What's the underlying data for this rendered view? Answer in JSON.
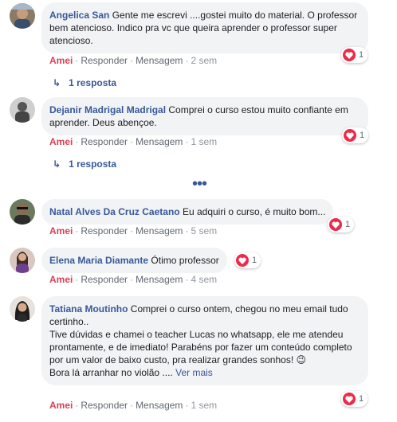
{
  "comments": [
    {
      "author": "Angelica San",
      "text": "Gente me escrevi ....gostei muito do material. O professor bem atencioso. Indico pra vc que queira aprender o professor super atencioso.",
      "like": "Amei",
      "reply": "Responder",
      "message": "Mensagem",
      "time": "2 sem",
      "reactions": "1",
      "replies": "1 resposta"
    },
    {
      "author": "Dejanir Madrigal Madrigal",
      "text": "Comprei o curso estou muito confiante em aprender. Deus abençoe.",
      "like": "Amei",
      "reply": "Responder",
      "message": "Mensagem",
      "time": "1 sem",
      "reactions": "1",
      "replies": "1 resposta"
    },
    {
      "author": "Natal Alves Da Cruz Caetano",
      "text": "Eu adquiri o curso, é muito bom...",
      "like": "Amei",
      "reply": "Responder",
      "message": "Mensagem",
      "time": "5 sem",
      "reactions": "1"
    },
    {
      "author": "Elena Maria Diamante",
      "text": "Ótimo professor",
      "like": "Amei",
      "reply": "Responder",
      "message": "Mensagem",
      "time": "4 sem",
      "reactions": "1"
    },
    {
      "author": "Tatiana Moutinho",
      "text_lines": [
        "Comprei o curso ontem, chegou no meu email tudo certinho..",
        "Tive dúvidas e chamei o teacher Lucas no whatsapp, ele me atendeu prontamente, e de imediato! Parabéns por fazer um conteúdo completo por um valor de baixo custo, pra realizar grandes sonhos! 😉",
        "Bora lá arranhar no violão ...."
      ],
      "see_more": "Ver mais",
      "like": "Amei",
      "reply": "Responder",
      "message": "Mensagem",
      "time": "1 sem",
      "reactions": "1"
    }
  ],
  "more_comments": "•••",
  "colors": {
    "author": "#385898",
    "bubble": "#f2f3f5",
    "love": "#d84156",
    "heart": "#f0284a",
    "meta": "#90949c"
  },
  "icons": {
    "reaction": "heart-icon",
    "reply_arrow": "reply-arrow-icon",
    "more": "more-dots-icon"
  }
}
